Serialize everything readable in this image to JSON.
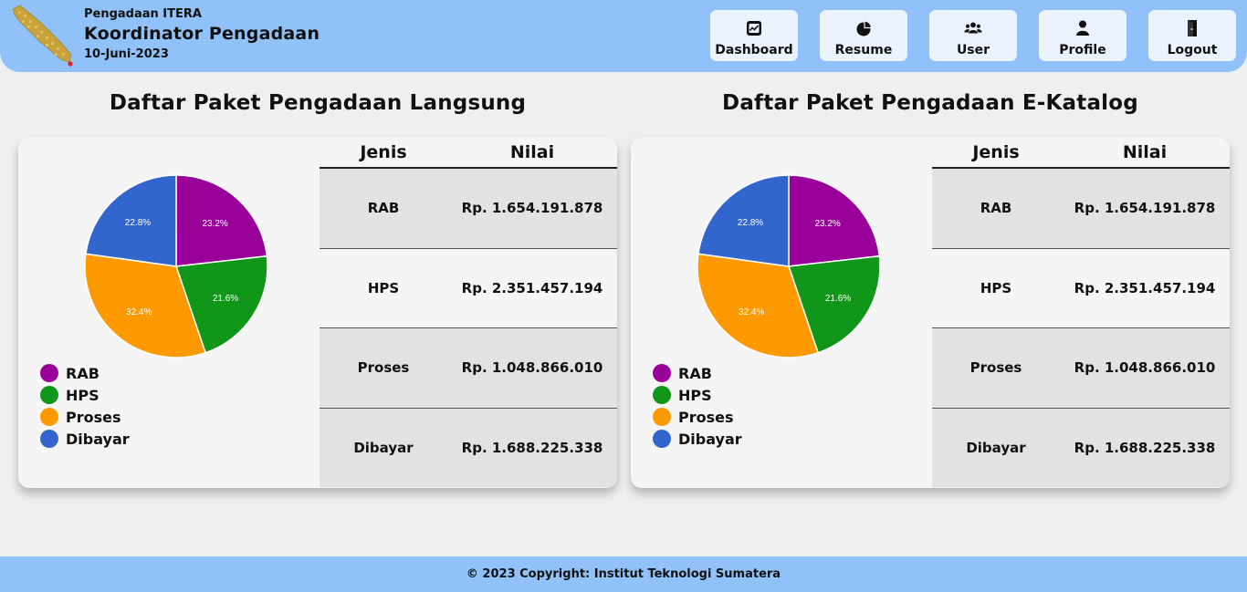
{
  "header": {
    "org": "Pengadaan ITERA",
    "role": "Koordinator Pengadaan",
    "date": "10-Juni-2023",
    "nav": [
      {
        "label": "Dashboard",
        "icon": "dashboard-icon"
      },
      {
        "label": "Resume",
        "icon": "pie-chart-icon"
      },
      {
        "label": "User",
        "icon": "users-icon"
      },
      {
        "label": "Profile",
        "icon": "person-icon"
      },
      {
        "label": "Logout",
        "icon": "logout-icon"
      }
    ]
  },
  "colors": {
    "header_bg": "#90c2f9",
    "RAB": "#990099",
    "HPS": "#109618",
    "Proses": "#ff9900",
    "Dibayar": "#3366cc"
  },
  "sections": [
    {
      "title": "Daftar Paket Pengadaan Langsung",
      "table": {
        "headers": [
          "Jenis",
          "Nilai"
        ],
        "rows": [
          {
            "jenis": "RAB",
            "nilai": "Rp. 1.654.191.878"
          },
          {
            "jenis": "HPS",
            "nilai": "Rp. 2.351.457.194"
          },
          {
            "jenis": "Proses",
            "nilai": "Rp. 1.048.866.010"
          },
          {
            "jenis": "Dibayar",
            "nilai": "Rp. 1.688.225.338"
          }
        ]
      }
    },
    {
      "title": "Daftar Paket Pengadaan E-Katalog",
      "table": {
        "headers": [
          "Jenis",
          "Nilai"
        ],
        "rows": [
          {
            "jenis": "RAB",
            "nilai": "Rp. 1.654.191.878"
          },
          {
            "jenis": "HPS",
            "nilai": "Rp. 2.351.457.194"
          },
          {
            "jenis": "Proses",
            "nilai": "Rp. 1.048.866.010"
          },
          {
            "jenis": "Dibayar",
            "nilai": "Rp. 1.688.225.338"
          }
        ]
      }
    }
  ],
  "chart_data": [
    {
      "type": "pie",
      "categories": [
        "RAB",
        "HPS",
        "Proses",
        "Dibayar"
      ],
      "values": [
        23.2,
        21.6,
        32.4,
        22.8
      ],
      "labels": [
        "23.2%",
        "21.6%",
        "32.4%",
        "22.8%"
      ],
      "colors": [
        "#990099",
        "#109618",
        "#ff9900",
        "#3366cc"
      ],
      "legend": "bottom-left"
    },
    {
      "type": "pie",
      "categories": [
        "RAB",
        "HPS",
        "Proses",
        "Dibayar"
      ],
      "values": [
        23.2,
        21.6,
        32.4,
        22.8
      ],
      "labels": [
        "23.2%",
        "21.6%",
        "32.4%",
        "22.8%"
      ],
      "colors": [
        "#990099",
        "#109618",
        "#ff9900",
        "#3366cc"
      ],
      "legend": "bottom-left"
    }
  ],
  "footer": {
    "text": "© 2023 Copyright: Institut Teknologi Sumatera"
  }
}
